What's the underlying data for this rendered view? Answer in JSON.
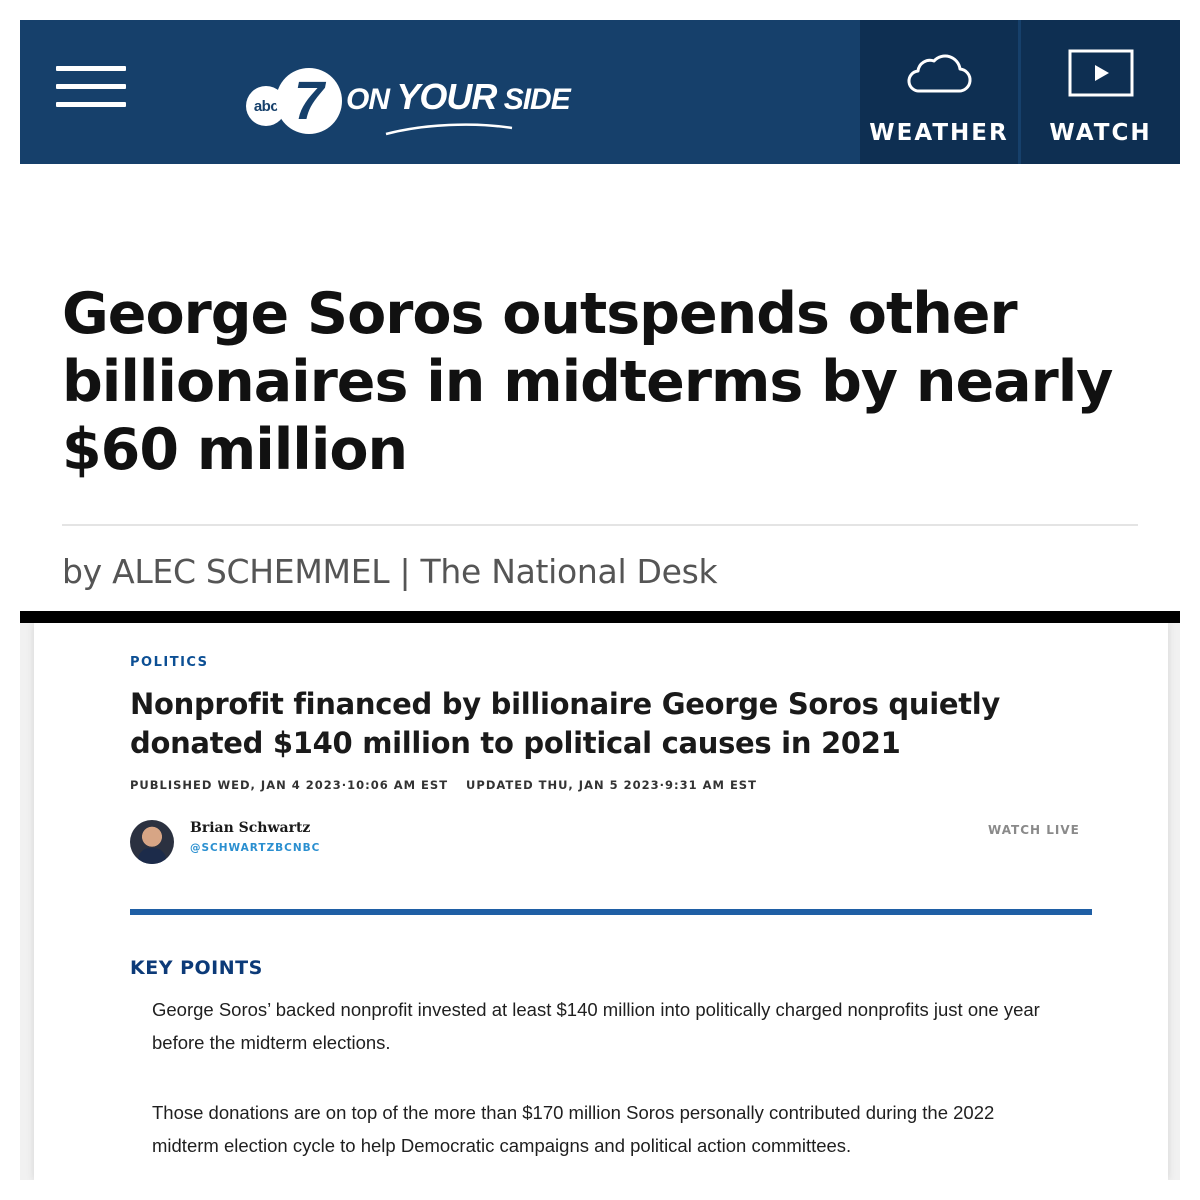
{
  "header": {
    "logo": {
      "abc": "abc",
      "seven": "7",
      "tagline_prefix": "ON ",
      "tagline_main": "YOUR",
      "tagline_suffix": " SIDE"
    },
    "weather_label": "WEATHER",
    "watch_label": "WATCH",
    "icons": [
      "menu-icon",
      "cloud-icon",
      "play-icon"
    ]
  },
  "article": {
    "headline": "George Soros outspends other billionaires in midterms by nearly $60 million",
    "byline": "by ALEC SCHEMMEL | The National Desk"
  },
  "embedded": {
    "kicker": "POLITICS",
    "title": "Nonprofit financed by billionaire George Soros quietly donated $140 million to political causes in 2021",
    "published": "PUBLISHED WED, JAN 4 2023·10:06 AM EST",
    "updated": "UPDATED THU, JAN 5 2023·9:31 AM EST",
    "author_name": "Brian Schwartz",
    "author_handle": "@SCHWARTZBCNBC",
    "watch_live": "WATCH LIVE",
    "key_points_label": "KEY POINTS",
    "key_points": [
      "George Soros’ backed nonprofit invested at least $140 million into politically charged nonprofits just one year before the midterm elections.",
      "Those donations are on top of the more than $170 million Soros personally contributed during the 2022 midterm election cycle to help Democratic campaigns and political action committees."
    ]
  },
  "colors": {
    "header_bg": "#16406b",
    "header_button_bg": "#0e2f52",
    "kicker_blue": "#0c4f94",
    "rule_blue": "#1f5fa5"
  }
}
